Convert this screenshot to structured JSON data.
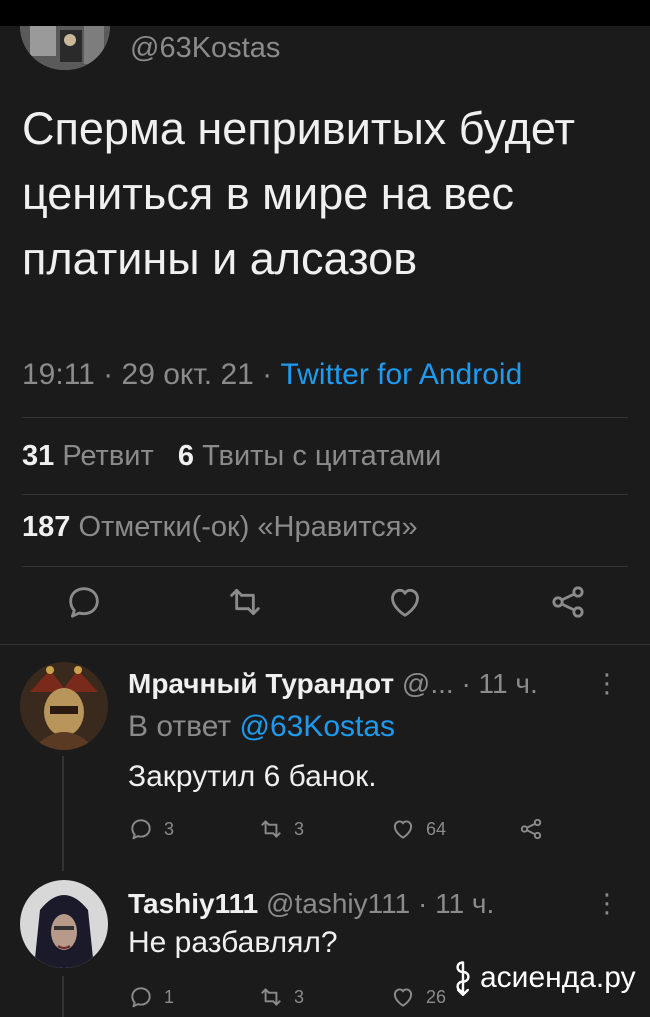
{
  "tweet": {
    "handle": "@63Kostas",
    "text": "Сперма непривитых будет цениться в мире на вес платины и алсазов",
    "time": "19:11 · 29 окт. 21 · ",
    "source": "Twitter for Android",
    "retweets_count": "31",
    "retweets_label": "Ретвит",
    "quotes_count": "6",
    "quotes_label": "Твиты с цитатами",
    "likes_count": "187",
    "likes_label": "Отметки(-ок) «Нравится»"
  },
  "replies": [
    {
      "name": "Мрачный Турандот",
      "handle": "@...",
      "time": "11 ч.",
      "reply_to_prefix": "В ответ ",
      "reply_to": "@63Kostas",
      "text": "Закрутил 6 банок.",
      "replies": "3",
      "retweets": "3",
      "likes": "64"
    },
    {
      "name": "Tashiy111",
      "handle": "@tashiy111",
      "time": "11 ч.",
      "text": "Не разбавлял?",
      "replies": "1",
      "retweets": "3",
      "likes": "26"
    }
  ],
  "watermark": "асиенда.ру",
  "icons": {
    "reply": "reply-icon",
    "retweet": "retweet-icon",
    "like": "heart-icon",
    "share": "share-icon",
    "more": "more-icon"
  },
  "colors": {
    "background": "#1b1b1b",
    "link": "#1d9bf0",
    "muted": "#8b8b8b",
    "text": "#f0f0f0"
  }
}
